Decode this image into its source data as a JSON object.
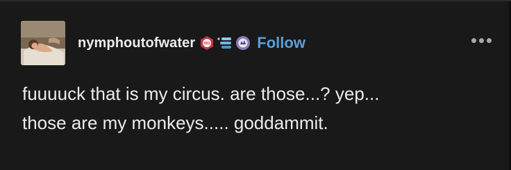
{
  "post": {
    "author": {
      "username": "nymphoutofwater",
      "avatar_icon": "avatar-photo",
      "badges": [
        {
          "icon": "red-hexagon-badge-icon",
          "text": "001",
          "color": "#c8353f"
        },
        {
          "icon": "blue-stack-badge-icon",
          "color": "#6fb6e2"
        },
        {
          "icon": "purple-circle-badge-icon",
          "color": "#8b7ab8"
        }
      ]
    },
    "follow_label": "Follow",
    "more_icon": "more-options-icon",
    "body_lines": [
      "fuuuuck that is my circus. are those...? yep...",
      "those are my monkeys..... goddammit."
    ]
  },
  "colors": {
    "background": "#191919",
    "text": "#ececec",
    "link": "#5a9fd8"
  }
}
